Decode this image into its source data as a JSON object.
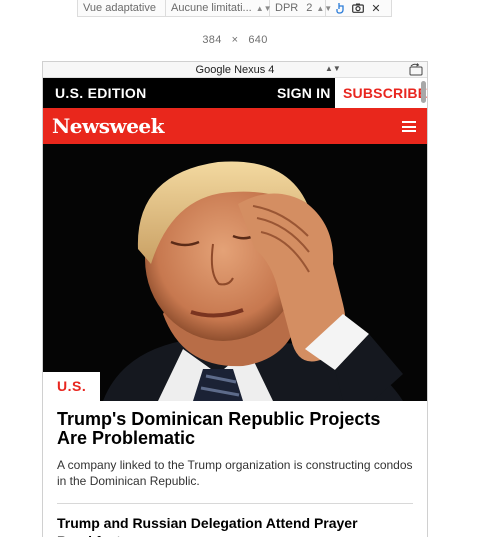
{
  "toolbar": {
    "mode_label": "Vue adaptative",
    "throttle_label": "Aucune limitati...",
    "dpr_label": "DPR",
    "dpr_value": "2",
    "touch_icon": "touch-icon",
    "screenshot_icon": "camera-icon",
    "close_icon": "close-icon"
  },
  "viewport": {
    "width": "384",
    "sep": "×",
    "height": "640"
  },
  "device": {
    "name": "Google Nexus 4",
    "rotate_icon": "rotate-icon"
  },
  "site": {
    "edition": "U.S. EDITION",
    "signin": "SIGN IN",
    "subscribe": "SUBSCRIBE",
    "logo": "Newsweek",
    "menu_icon": "hamburger-menu-icon",
    "colors": {
      "brand_red": "#e9271c",
      "black": "#000000"
    }
  },
  "hero": {
    "badge": "U.S."
  },
  "article": {
    "headline": "Trump's Dominican Republic Projects Are Problematic",
    "dek": "A company linked to the Trump organization is constructing condos in the Dominican Republic."
  },
  "next_article": {
    "headline": "Trump and Russian Delegation Attend Prayer Breakfast"
  }
}
